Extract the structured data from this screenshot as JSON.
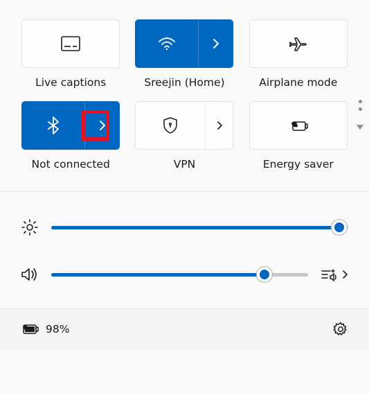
{
  "colors": {
    "accent": "#0067c0",
    "highlight": "#e81123"
  },
  "tiles": [
    {
      "id": "live-captions",
      "label": "Live captions",
      "active": false,
      "split": false
    },
    {
      "id": "wifi",
      "label": "Sreejin (Home)",
      "active": true,
      "split": true
    },
    {
      "id": "airplane",
      "label": "Airplane mode",
      "active": false,
      "split": false
    },
    {
      "id": "bluetooth",
      "label": "Not connected",
      "active": true,
      "split": true,
      "highlighted": true
    },
    {
      "id": "vpn",
      "label": "VPN",
      "active": false,
      "split": true
    },
    {
      "id": "energy-saver",
      "label": "Energy saver",
      "active": false,
      "split": false
    }
  ],
  "brightness": {
    "value": 97
  },
  "volume": {
    "value": 83
  },
  "battery": {
    "percent_text": "98%"
  }
}
